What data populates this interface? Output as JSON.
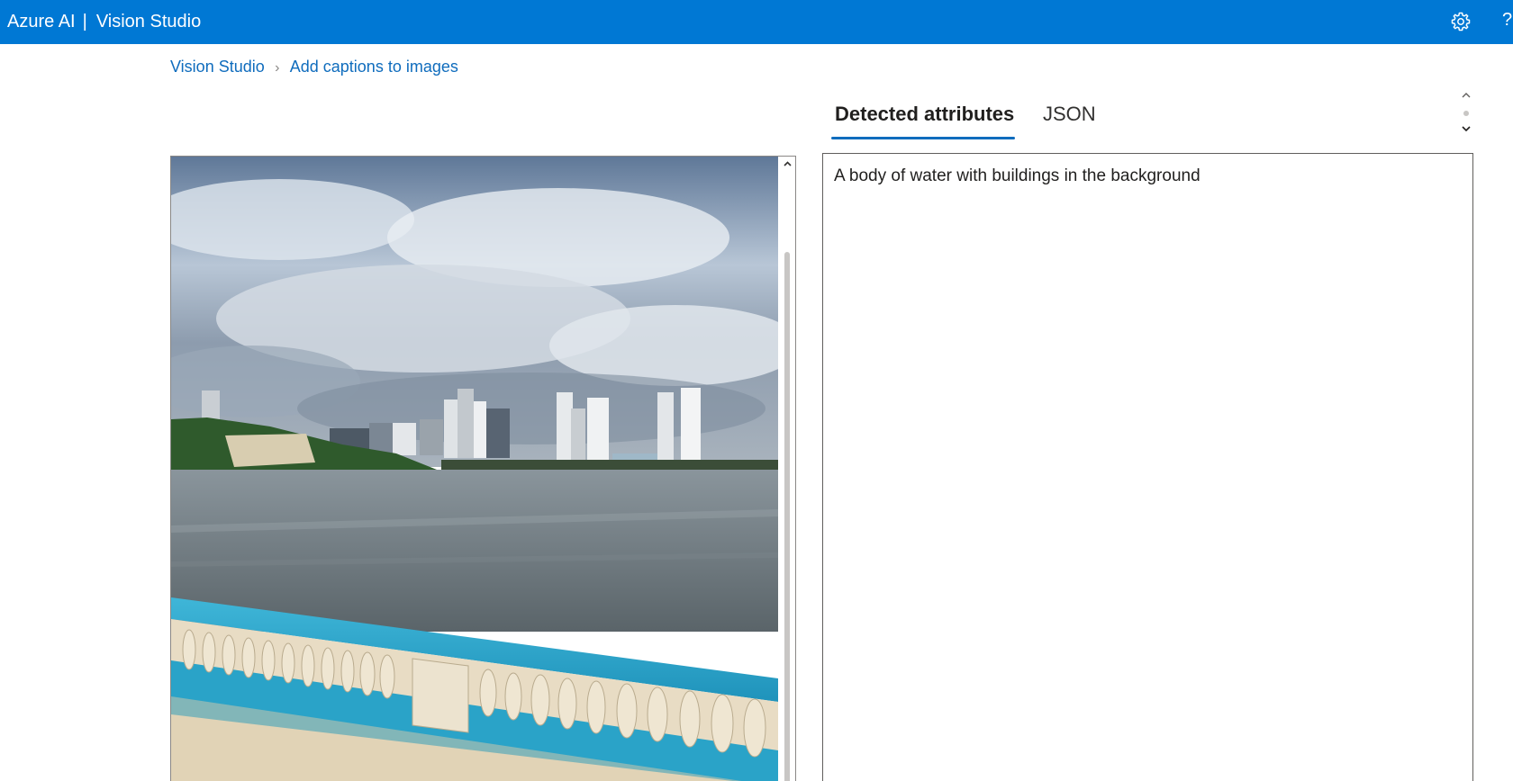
{
  "header": {
    "brand": "Azure AI",
    "separator": "|",
    "product": "Vision Studio",
    "settings_icon": "gear-icon",
    "help_icon": "question-icon",
    "bg_color": "#0078d4"
  },
  "breadcrumb": {
    "items": [
      "Vision Studio",
      "Add captions to images"
    ],
    "separator_icon": "chevron-right-icon"
  },
  "tabs": [
    {
      "label": "Detected attributes",
      "selected": true
    },
    {
      "label": "JSON",
      "selected": false
    }
  ],
  "image_panel": {
    "image_icon": "photo-river-skyline",
    "scroll_icon": "chevron-up-icon"
  },
  "results": {
    "caption": "A body of water with buildings in the background"
  },
  "colors": {
    "accent": "#0f6cbd",
    "border": "#8a8886"
  }
}
